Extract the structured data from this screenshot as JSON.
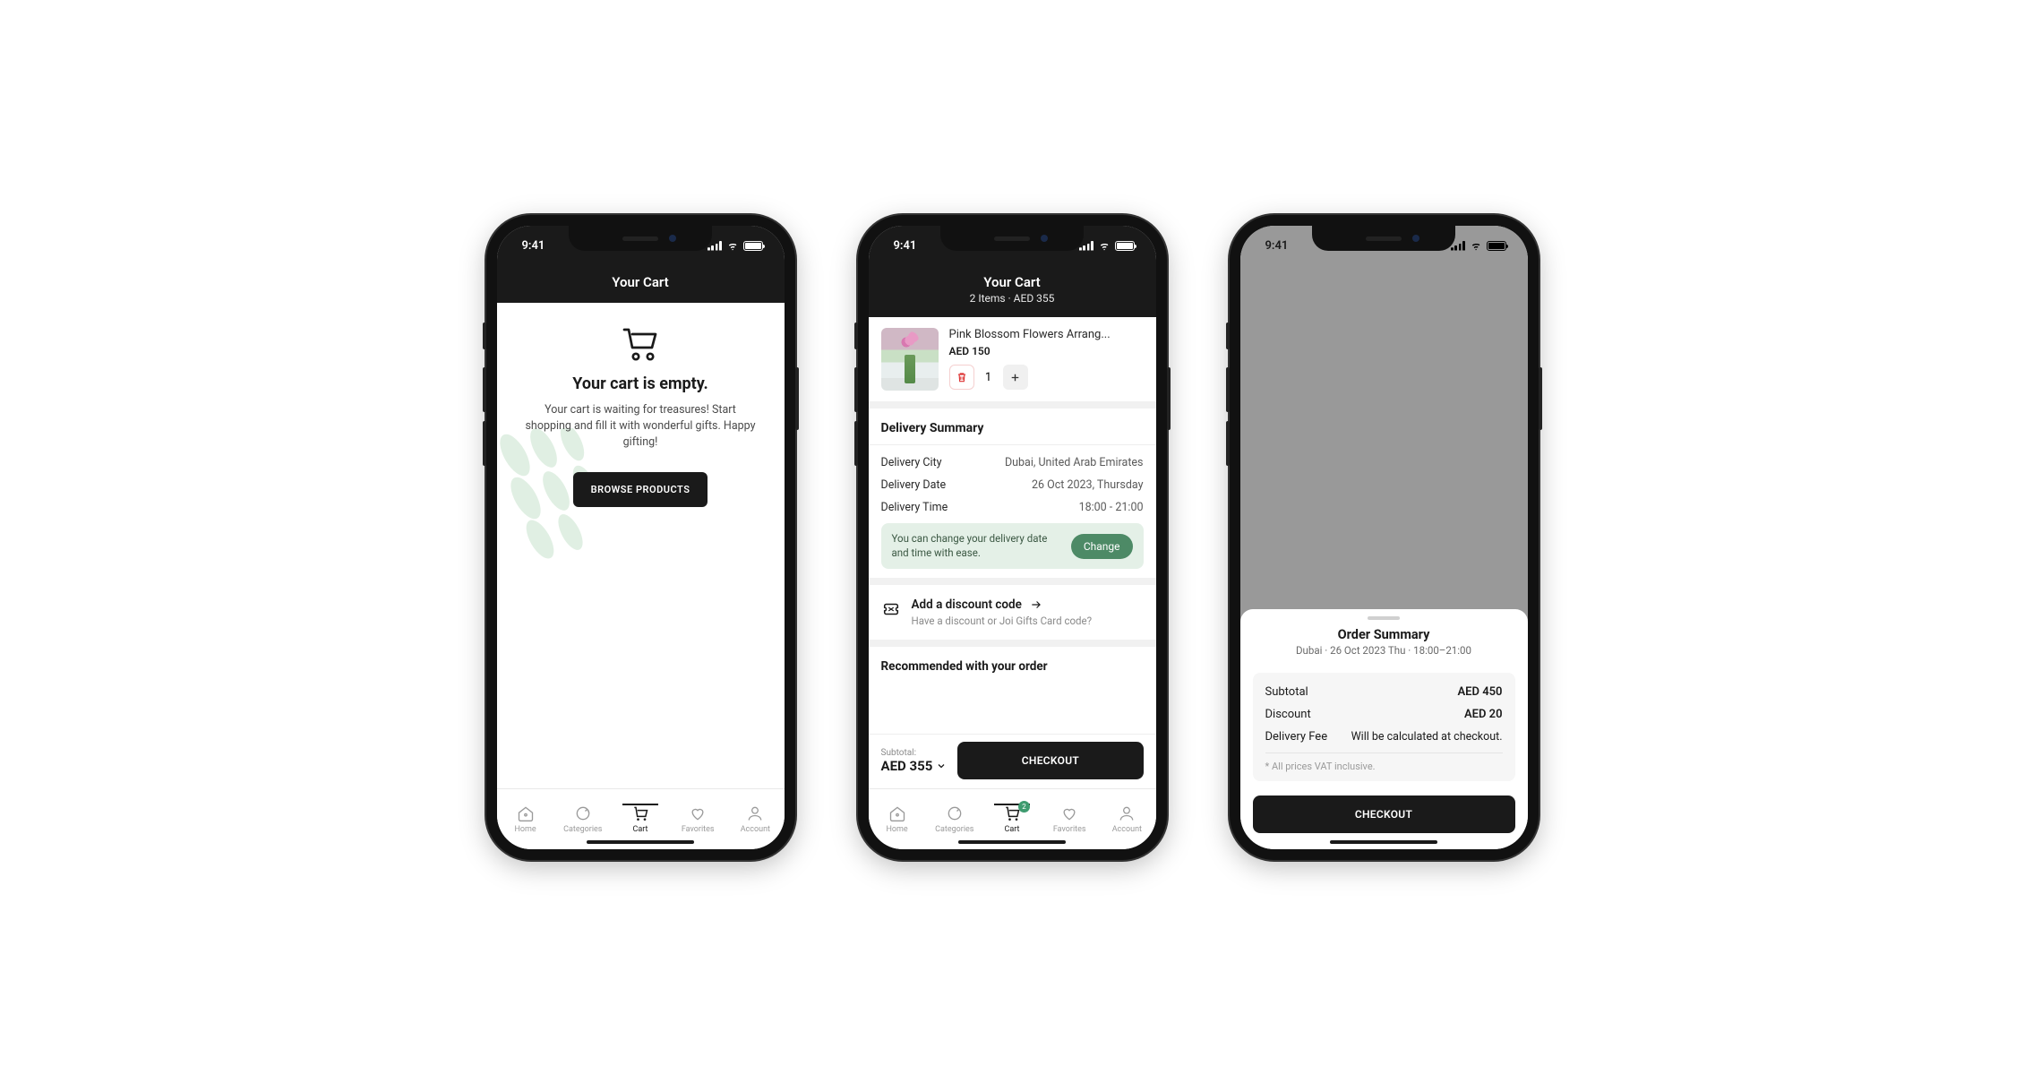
{
  "status": {
    "time": "9:41"
  },
  "screen1": {
    "title": "Your Cart",
    "empty_title": "Your cart is empty.",
    "empty_text": "Your cart is waiting for treasures! Start shopping and fill it with wonderful gifts. Happy gifting!",
    "browse_label": "BROWSE PRODUCTS"
  },
  "tabs": {
    "home": "Home",
    "categories": "Categories",
    "cart": "Cart",
    "favorites": "Favorites",
    "account": "Account",
    "badge": "2"
  },
  "screen2": {
    "title": "Your Cart",
    "subtitle": "2 Items · AED 355",
    "item": {
      "name": "Pink Blossom Flowers Arrang...",
      "price": "AED 150",
      "qty": "1"
    },
    "delivery": {
      "heading": "Delivery Summary",
      "city_label": "Delivery City",
      "city_value": "Dubai, United Arab Emirates",
      "date_label": "Delivery Date",
      "date_value": "26 Oct 2023, Thursday",
      "time_label": "Delivery Time",
      "time_value": "18:00 - 21:00",
      "change_text": "You can change your delivery date and time with ease.",
      "change_label": "Change"
    },
    "discount": {
      "title": "Add a discount code",
      "subtitle": "Have a discount or Joi Gifts Card code?"
    },
    "recommended_title": "Recommended with your order",
    "subtotal_label": "Subtotal:",
    "subtotal_value": "AED 355",
    "checkout_label": "CHECKOUT"
  },
  "screen3": {
    "title": "Order Summary",
    "subtitle": "Dubai · 26 Oct 2023 Thu · 18:00–21:00",
    "rows": {
      "subtotal_label": "Subtotal",
      "subtotal_value": "AED 450",
      "discount_label": "Discount",
      "discount_value": "AED 20",
      "delivery_label": "Delivery Fee",
      "delivery_value": "Will be calculated at checkout."
    },
    "vat_note": "* All prices VAT inclusive.",
    "checkout_label": "CHECKOUT"
  }
}
